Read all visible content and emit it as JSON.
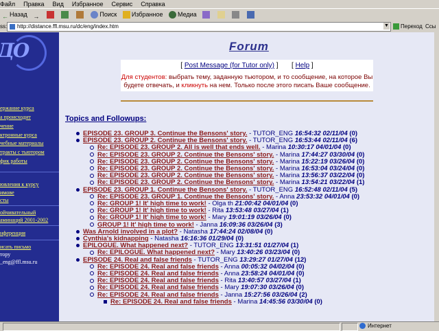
{
  "menu": [
    "Файл",
    "Правка",
    "Вид",
    "Избранное",
    "Сервис",
    "Справка"
  ],
  "toolbar": {
    "back_label": "Назад",
    "search_label": "Поиск",
    "favorites_label": "Избранное",
    "media_label": "Медиа"
  },
  "address": {
    "label": "ss:",
    "url": "http://distance.ffl.msu.ru/dc/eng/index.htm",
    "go_label": "Переход",
    "links_label": "Ссы"
  },
  "nav": {
    "logo": "ДО",
    "items": [
      "ержание курса",
      "а происходит",
      "чение",
      "ктронные курса",
      "чебные материалы",
      "тракты с тьютором",
      "фик работы",
      "ювления к курсу",
      "имове",
      "сты",
      "ойчивательный",
      "аминаций 2001-2002",
      "нференция",
      "исать письмо",
      "тору",
      "_eng@ffl.msu.ru"
    ]
  },
  "page": {
    "title": "Forum",
    "post_message": "Post Message (for Tutor only)",
    "help": "Help",
    "notice_pre": "Для студентов:",
    "notice_1": " выбрать тему, заданную тьютором, и то сообщение, на которое Вы будете отвечать, и ",
    "notice_click": "кликнуть",
    "notice_2": " на нем. Только после этого писать Ваше сообщение.",
    "topics_header": "Topics and Followups:"
  },
  "topics": [
    {
      "level": 0,
      "title": "EPISODE 23. GROUP 3. Continue the Bensons' story.",
      "author": "TUTOR_ENG",
      "date": "16:54:32 02/11/04",
      "count": "(0)"
    },
    {
      "level": 0,
      "title": "EPISODE 23. GROUP 2. Continue the Bensons' story.",
      "author": "TUTOR_ENG",
      "date": "16:53:44 02/11/04",
      "count": "(6)"
    },
    {
      "level": 1,
      "title": "Re: EPISODE 23. GROUP 2. All is well that ends well.",
      "author": "Marina",
      "date": "10:30:17 04/01/04",
      "count": "(0)"
    },
    {
      "level": 1,
      "title": "Re: EPISODE 23. GROUP 2. Continue the Bensons' story.",
      "author": "Marina",
      "date": "17:44:27 03/30/04",
      "count": "(0)"
    },
    {
      "level": 1,
      "title": "Re: EPISODE 23. GROUP 2. Continue the Bensons' story.",
      "author": "Marina",
      "date": "15:22:19 03/26/04",
      "count": "(0)"
    },
    {
      "level": 1,
      "title": "Re: EPISODE 23. GROUP 2. Continue the Bensons' story.",
      "author": "Marina",
      "date": "16:53:04 03/24/04",
      "count": "(0)"
    },
    {
      "level": 1,
      "title": "Re: EPISODE 23. GROUP 2. Continue the Bensons' story.",
      "author": "Marina",
      "date": "13:56:37 03/22/04",
      "count": "(0)"
    },
    {
      "level": 1,
      "title": "Re: EPISODE 23. GROUP 2. Continue the Bensons' story.",
      "author": "Marina",
      "date": "13:54:21 03/22/04",
      "count": "(1)"
    },
    {
      "level": 0,
      "title": "EPISODE 23. GROUP 1. Continue the Bensons' story.",
      "author": "TUTOR_ENG",
      "date": "16:52:48 02/11/04",
      "count": "(5)"
    },
    {
      "level": 1,
      "title": "Re: EPISODE 23. GROUP 1. Continue the Bensons' story.",
      "author": "Anna",
      "date": "23:53:32 04/01/04",
      "count": "(0)"
    },
    {
      "level": 1,
      "title": "Re: GROUP 1! It' high time to work!",
      "author": "Olga th",
      "date": "21:00:42 04/01/04",
      "count": "(0)"
    },
    {
      "level": 1,
      "title": "Re: GROUP 1! It' high time to work!",
      "author": "Rita",
      "date": "13:53:48 03/27/04",
      "count": "(1)"
    },
    {
      "level": 1,
      "title": "Re: GROUP 1! It' high time to work!",
      "author": "Mary",
      "date": "19:01:19 03/26/04",
      "count": "(0)"
    },
    {
      "level": 1,
      "title": "GROUP 1! It' high time to work!",
      "author": "Janna",
      "date": "16:09:36 03/26/04",
      "count": "(3)"
    },
    {
      "level": 0,
      "title": "Was Arnold involved in a plot?",
      "author": "Natasha",
      "date": "17:44:24 02/08/04",
      "count": "(0)"
    },
    {
      "level": 0,
      "title": "Cynthia's kidnapping",
      "author": "Natasha",
      "date": "16:16:36 01/29/04",
      "count": "(0)"
    },
    {
      "level": 0,
      "title": "EPILOGUE. What happened next?",
      "author": "TUTOR_ENG",
      "date": "13:31:51 01/27/04",
      "count": "(1)"
    },
    {
      "level": 1,
      "title": "Re: EPILOGUE. What happened next?",
      "author": "Mary",
      "date": "13:40:26 03/23/04",
      "count": "(0)"
    },
    {
      "level": 0,
      "title": "EPISODE 24. Real and false friends",
      "author": "TUTOR_ENG",
      "date": "13:29:27 01/27/04",
      "count": "(12)"
    },
    {
      "level": 1,
      "title": "Re: EPISODE 24. Real and false friends",
      "author": "Anna",
      "date": "00:05:32 04/02/04",
      "count": "(0)"
    },
    {
      "level": 1,
      "title": "Re: EPISODE 24. Real and false friends",
      "author": "Anna",
      "date": "23:58:24 04/01/04",
      "count": "(0)"
    },
    {
      "level": 1,
      "title": "Re: EPISODE 24. Real and false friends",
      "author": "Rita",
      "date": "13:40:57 03/27/04",
      "count": "(1)"
    },
    {
      "level": 1,
      "title": "Re: EPISODE 24. Real and false friends",
      "author": "Mary",
      "date": "19:07:30 03/26/04",
      "count": "(0)"
    },
    {
      "level": 1,
      "title": "Re: EPISODE 24. Real and false friends",
      "author": "Janna",
      "date": "15:27:56 03/26/04",
      "count": "(2)"
    },
    {
      "level": 2,
      "title": "Re: EPISODE 24. Real and false friends",
      "author": "Marina",
      "date": "14:45:56 03/30/04",
      "count": "(0)"
    }
  ],
  "status": {
    "zone": "Интернет"
  }
}
